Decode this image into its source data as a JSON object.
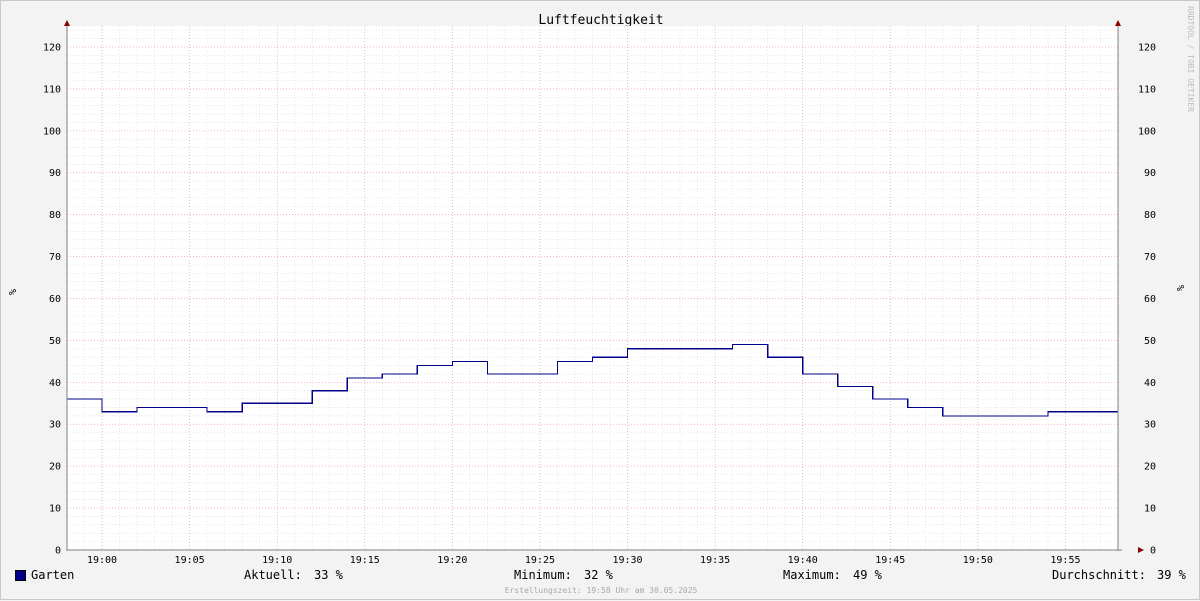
{
  "colors": {
    "series": "#00008b",
    "background": "#f3f3f3",
    "plot_background": "#ffffff",
    "major_grid": "#f0a0a0",
    "minor_grid": "#d8d8d8",
    "axis": "#808080",
    "arrow": "#8b0000"
  },
  "watermark": "RRDTOOL / TOBI OETIKER",
  "chart_data": {
    "type": "line",
    "title": "Luftfeuchtigkeit",
    "ylabel": "%",
    "ylabel_right": "%",
    "ylim": [
      0,
      125
    ],
    "yticks": [
      0,
      10,
      20,
      30,
      40,
      50,
      60,
      70,
      80,
      90,
      100,
      110,
      120
    ],
    "xlim": [
      "18:58",
      "19:58"
    ],
    "xticks": [
      "19:00",
      "19:05",
      "19:10",
      "19:15",
      "19:20",
      "19:25",
      "19:30",
      "19:35",
      "19:40",
      "19:45",
      "19:50",
      "19:55"
    ],
    "grid": true,
    "series": [
      {
        "name": "Garten",
        "step": true,
        "points": [
          [
            "18:58",
            36
          ],
          [
            "19:00",
            33
          ],
          [
            "19:02",
            34
          ],
          [
            "19:06",
            33
          ],
          [
            "19:08",
            35
          ],
          [
            "19:12",
            38
          ],
          [
            "19:14",
            41
          ],
          [
            "19:16",
            42
          ],
          [
            "19:18",
            44
          ],
          [
            "19:20",
            45
          ],
          [
            "19:22",
            42
          ],
          [
            "19:26",
            45
          ],
          [
            "19:28",
            46
          ],
          [
            "19:30",
            48
          ],
          [
            "19:36",
            49
          ],
          [
            "19:38",
            46
          ],
          [
            "19:40",
            42
          ],
          [
            "19:42",
            39
          ],
          [
            "19:44",
            36
          ],
          [
            "19:46",
            34
          ],
          [
            "19:48",
            32
          ],
          [
            "19:54",
            33
          ],
          [
            "19:56",
            33
          ],
          [
            "19:58",
            33
          ]
        ]
      }
    ]
  },
  "legend": {
    "series_name": "Garten",
    "aktuell_label": "Aktuell:",
    "aktuell_value": "33 %",
    "minimum_label": "Minimum:",
    "minimum_value": "32 %",
    "maximum_label": "Maximum:",
    "maximum_value": "49 %",
    "durchschnitt_label": "Durchschnitt:",
    "durchschnitt_value": "39 %"
  },
  "footer": "Erstellungszeit: 19:58 Uhr am 30.05.2025"
}
